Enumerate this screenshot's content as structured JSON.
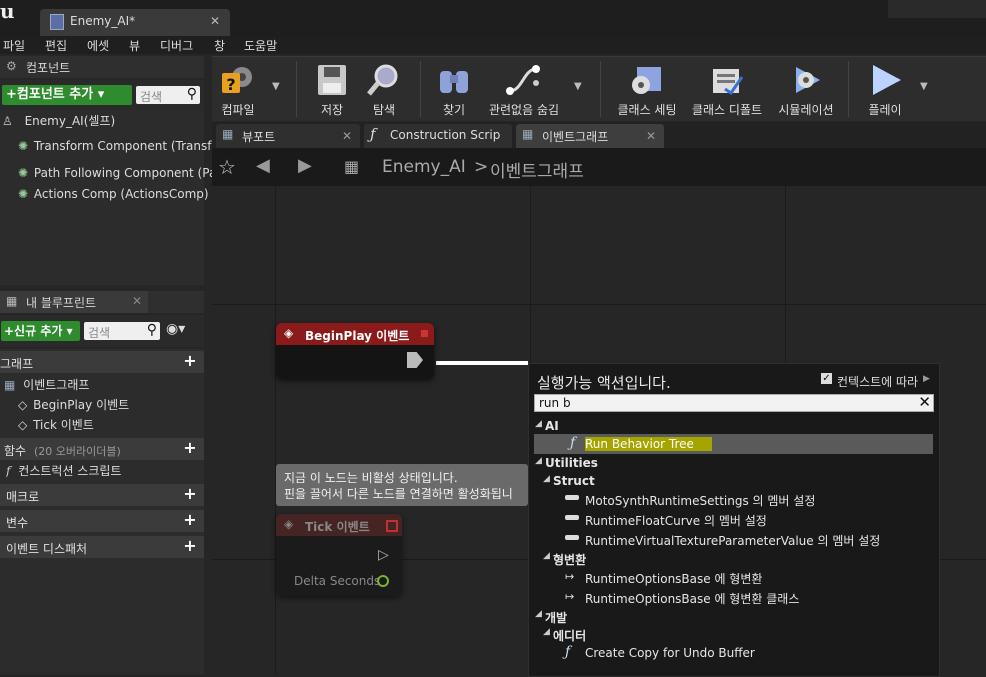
{
  "window": {
    "doc_tab": "Enemy_AI*",
    "doc_tab_close": "✕"
  },
  "menu": [
    "파일",
    "편집",
    "에셋",
    "뷰",
    "디버그",
    "창",
    "도움말"
  ],
  "components": {
    "header": "컴포넌트",
    "add_button": "+컴포넌트 추가 ▾",
    "search_placeholder": "검색",
    "items": [
      "Enemy_AI(셀프)",
      "Transform Component (Transf",
      "Path Following Component (Pa",
      "Actions Comp (ActionsComp) ("
    ]
  },
  "my_blueprint": {
    "tab": "내 블루프린트",
    "new_button": "+신규 추가 ▾",
    "search_placeholder": "검색",
    "sections": {
      "graph": "그래프",
      "functions": "함수",
      "functions_count": "(20 오버라이더블)",
      "macros": "매크로",
      "variables": "변수",
      "dispatchers": "이벤트 디스패처"
    },
    "graph_items": [
      "이벤트그래프",
      "BeginPlay 이벤트",
      "Tick 이벤트"
    ],
    "function_items": [
      "컨스트럭션 스크립트"
    ]
  },
  "toolbar": {
    "buttons": [
      "컴파일",
      "저장",
      "탐색",
      "찾기",
      "관련없음 숨김",
      "클래스 세팅",
      "클래스 디폴트",
      "시뮬레이션",
      "플레이"
    ]
  },
  "editor_tabs": [
    "뷰포트",
    "Construction Scrip",
    "이벤트그래프"
  ],
  "breadcrumb": {
    "root": "Enemy_AI",
    "sep": ">",
    "current": "이벤트그래프"
  },
  "nodes": {
    "beginplay": "BeginPlay 이벤트",
    "tick": "Tick 이벤트",
    "tick_pin": "Delta Seconds"
  },
  "tooltip": {
    "line1": "지금 이 노드는 비활성 상태입니다.",
    "line2": "핀을 끌어서 다른 노드를 연결하면 활성화됩니"
  },
  "context_menu": {
    "title": "실행가능 액션입니다.",
    "context_label": "컨텍스트에 따라",
    "context_checked": true,
    "search_value": "run b",
    "rows": [
      {
        "text": "AI",
        "kind": "category",
        "indent": 0
      },
      {
        "text": "Run Behavior Tree",
        "kind": "function",
        "indent": 2,
        "selected": true
      },
      {
        "text": "Utilities",
        "kind": "category",
        "indent": 0
      },
      {
        "text": "Struct",
        "kind": "category",
        "indent": 1
      },
      {
        "text": "MotoSynthRuntimeSettings 의 멤버 설정",
        "kind": "member",
        "indent": 2
      },
      {
        "text": "RuntimeFloatCurve 의 멤버 설정",
        "kind": "member",
        "indent": 2
      },
      {
        "text": "RuntimeVirtualTextureParameterValue 의 멤버 설정",
        "kind": "member",
        "indent": 2
      },
      {
        "text": "형변환",
        "kind": "category",
        "indent": 1
      },
      {
        "text": "RuntimeOptionsBase 에 형변환",
        "kind": "cast",
        "indent": 2
      },
      {
        "text": "RuntimeOptionsBase 에 형변환 클래스",
        "kind": "cast",
        "indent": 2
      },
      {
        "text": "개발",
        "kind": "category",
        "indent": 0
      },
      {
        "text": "에디터",
        "kind": "category",
        "indent": 1
      },
      {
        "text": "Create Copy for Undo Buffer",
        "kind": "function",
        "indent": 2
      }
    ]
  },
  "colors": {
    "accent_green": "#2e8b2e",
    "event_red": "#8b1a1a",
    "highlight": "#a5a500"
  }
}
